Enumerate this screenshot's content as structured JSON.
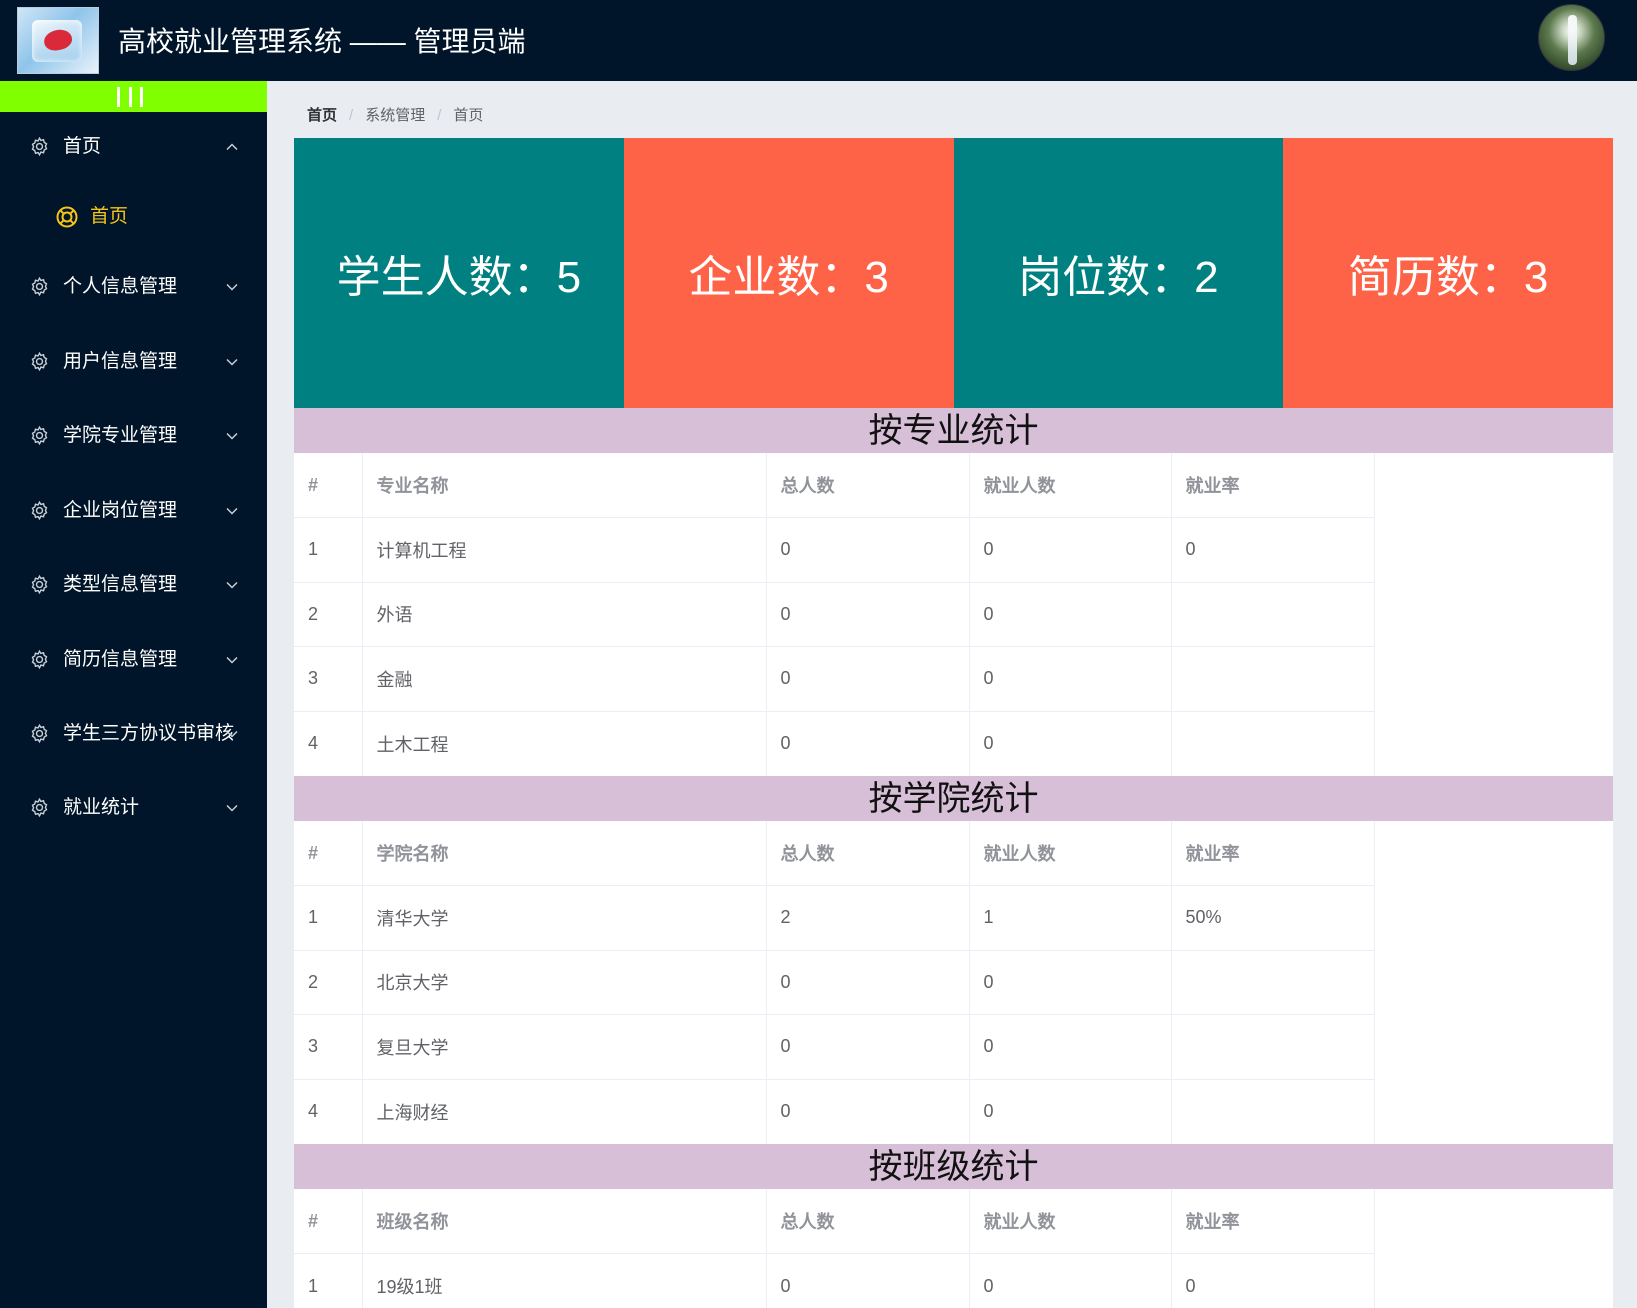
{
  "header": {
    "title": "高校就业管理系统 —— 管理员端",
    "logo_icon": "ice-cube-heart-logo",
    "avatar_icon": "waterfall-avatar",
    "bg_color": "#001529"
  },
  "sidebar": {
    "collapse_icon": "three-bars-icon",
    "collapse_color": "#7fff00",
    "items": [
      {
        "label": "首页",
        "icon": "gear-icon",
        "expanded": true,
        "chevron": "chevron-up-icon"
      },
      {
        "label": "个人信息管理",
        "icon": "gear-icon",
        "expanded": false,
        "chevron": "chevron-down-icon"
      },
      {
        "label": "用户信息管理",
        "icon": "gear-icon",
        "expanded": false,
        "chevron": "chevron-down-icon"
      },
      {
        "label": "学院专业管理",
        "icon": "gear-icon",
        "expanded": false,
        "chevron": "chevron-down-icon"
      },
      {
        "label": "企业岗位管理",
        "icon": "gear-icon",
        "expanded": false,
        "chevron": "chevron-down-icon"
      },
      {
        "label": "类型信息管理",
        "icon": "gear-icon",
        "expanded": false,
        "chevron": "chevron-down-icon"
      },
      {
        "label": "简历信息管理",
        "icon": "gear-icon",
        "expanded": false,
        "chevron": "chevron-down-icon"
      },
      {
        "label": "学生三方协议书审核",
        "icon": "gear-icon",
        "expanded": false,
        "chevron": "chevron-down-icon"
      },
      {
        "label": "就业统计",
        "icon": "gear-icon",
        "expanded": false,
        "chevron": "chevron-down-icon"
      }
    ],
    "sub_items": [
      {
        "label": "首页",
        "icon": "lifebuoy-icon",
        "active": true,
        "active_color": "#f5c518"
      }
    ]
  },
  "breadcrumb": [
    "首页",
    "系统管理",
    "首页"
  ],
  "stats": [
    {
      "label": "学生人数：5",
      "color": "#008080"
    },
    {
      "label": "企业数：3",
      "color": "#ff6347"
    },
    {
      "label": "岗位数：2",
      "color": "#008080"
    },
    {
      "label": "简历数：3",
      "color": "#ff6347"
    }
  ],
  "sections": [
    {
      "title": "按专业统计",
      "headers": [
        "#",
        "专业名称",
        "总人数",
        "就业人数",
        "就业率"
      ],
      "rows": [
        [
          "1",
          "计算机工程",
          "0",
          "0",
          "0"
        ],
        [
          "2",
          "外语",
          "0",
          "0",
          ""
        ],
        [
          "3",
          "金融",
          "0",
          "0",
          ""
        ],
        [
          "4",
          "土木工程",
          "0",
          "0",
          ""
        ]
      ]
    },
    {
      "title": "按学院统计",
      "headers": [
        "#",
        "学院名称",
        "总人数",
        "就业人数",
        "就业率"
      ],
      "rows": [
        [
          "1",
          "清华大学",
          "2",
          "1",
          "50%"
        ],
        [
          "2",
          "北京大学",
          "0",
          "0",
          ""
        ],
        [
          "3",
          "复旦大学",
          "0",
          "0",
          ""
        ],
        [
          "4",
          "上海财经",
          "0",
          "0",
          ""
        ]
      ]
    },
    {
      "title": "按班级统计",
      "headers": [
        "#",
        "班级名称",
        "总人数",
        "就业人数",
        "就业率"
      ],
      "rows": [
        [
          "1",
          "19级1班",
          "0",
          "0",
          "0"
        ]
      ]
    }
  ],
  "colors": {
    "section_bg": "#d8bfd8",
    "main_bg": "#e9edf2"
  }
}
